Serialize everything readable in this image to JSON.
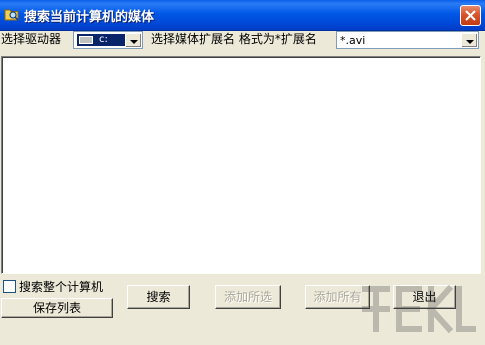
{
  "window": {
    "title": "搜索当前计算机的媒体",
    "icon": "folder-search-icon",
    "close_icon": "close-icon"
  },
  "drive_selector": {
    "label": "选择驱动器",
    "selected_drive": "c:"
  },
  "extension_selector": {
    "label": "选择媒体扩展名 格式为*扩展名",
    "selected": "*.avi"
  },
  "results_list": {
    "items": []
  },
  "options": {
    "search_all_label": "搜索整个计算机",
    "search_all_checked": false
  },
  "buttons": {
    "save_list": "保存列表",
    "search": "搜索",
    "add_selected": "添加所选",
    "add_all": "添加所有",
    "exit": "退出"
  },
  "colors": {
    "titlebar": "#0058e6",
    "window_face": "#ece9d8",
    "close_button": "#d9542c",
    "disabled_text": "#aca899"
  }
}
